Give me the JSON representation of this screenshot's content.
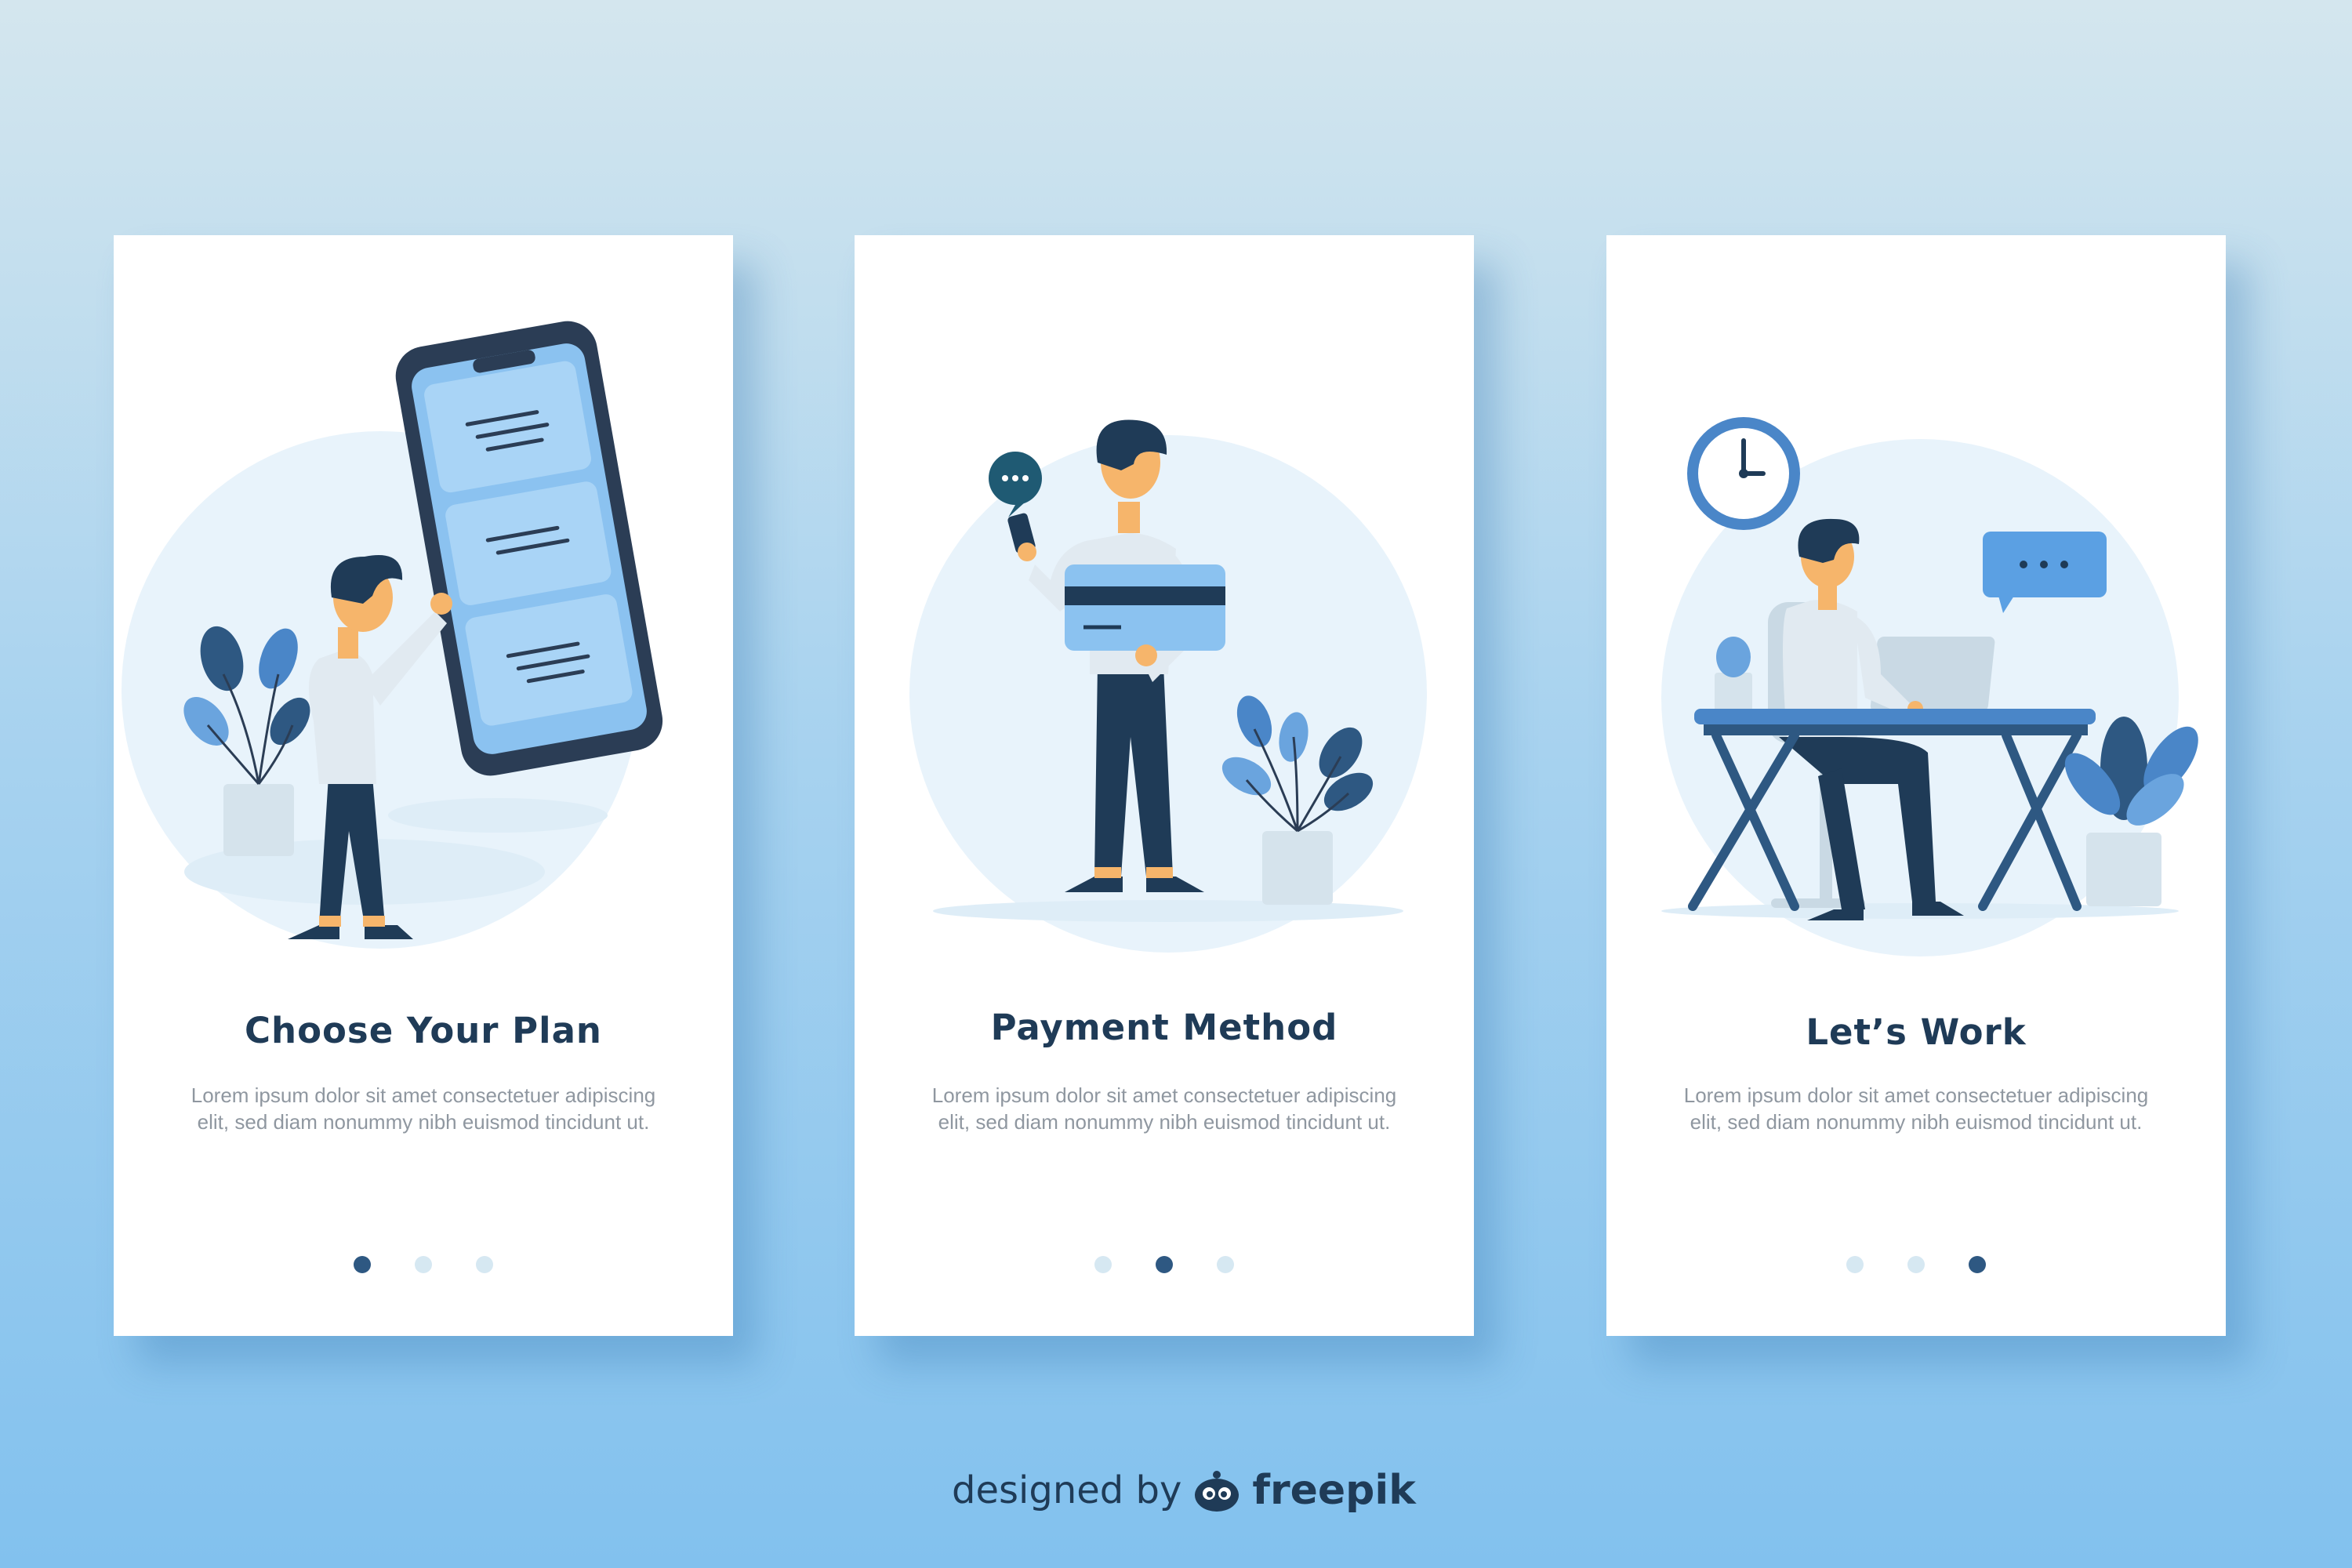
{
  "screens": [
    {
      "title": "Choose Your Plan",
      "body": "Lorem ipsum dolor sit amet consectetuer adipiscing elit, sed diam nonummy nibh euismod tincidunt ut.",
      "illustration": "man-tapping-giant-phone",
      "active_dot": 1
    },
    {
      "title": "Payment Method",
      "body": "Lorem ipsum dolor sit amet consectetuer adipiscing elit, sed diam nonummy nibh euismod tincidunt ut.",
      "illustration": "man-holding-credit-card",
      "active_dot": 2
    },
    {
      "title": "Let’s Work",
      "body": "Lorem ipsum dolor sit amet consectetuer adipiscing elit, sed diam nonummy nibh euismod tincidunt ut.",
      "illustration": "man-working-at-desk",
      "active_dot": 3
    }
  ],
  "dots_per_screen": 3,
  "credit": {
    "text": "designed by",
    "brand": "freepik",
    "icon": "freepik-logo-icon"
  },
  "colors": {
    "title": "#1f3b57",
    "body_text": "#8f97a0",
    "dot_active": "#2e5882",
    "dot_inactive": "#d6e8f2",
    "accent_blue": "#4a86c8",
    "light_blue": "#9ccbf2",
    "navy": "#1f3b57",
    "skin": "#f6b56b"
  }
}
